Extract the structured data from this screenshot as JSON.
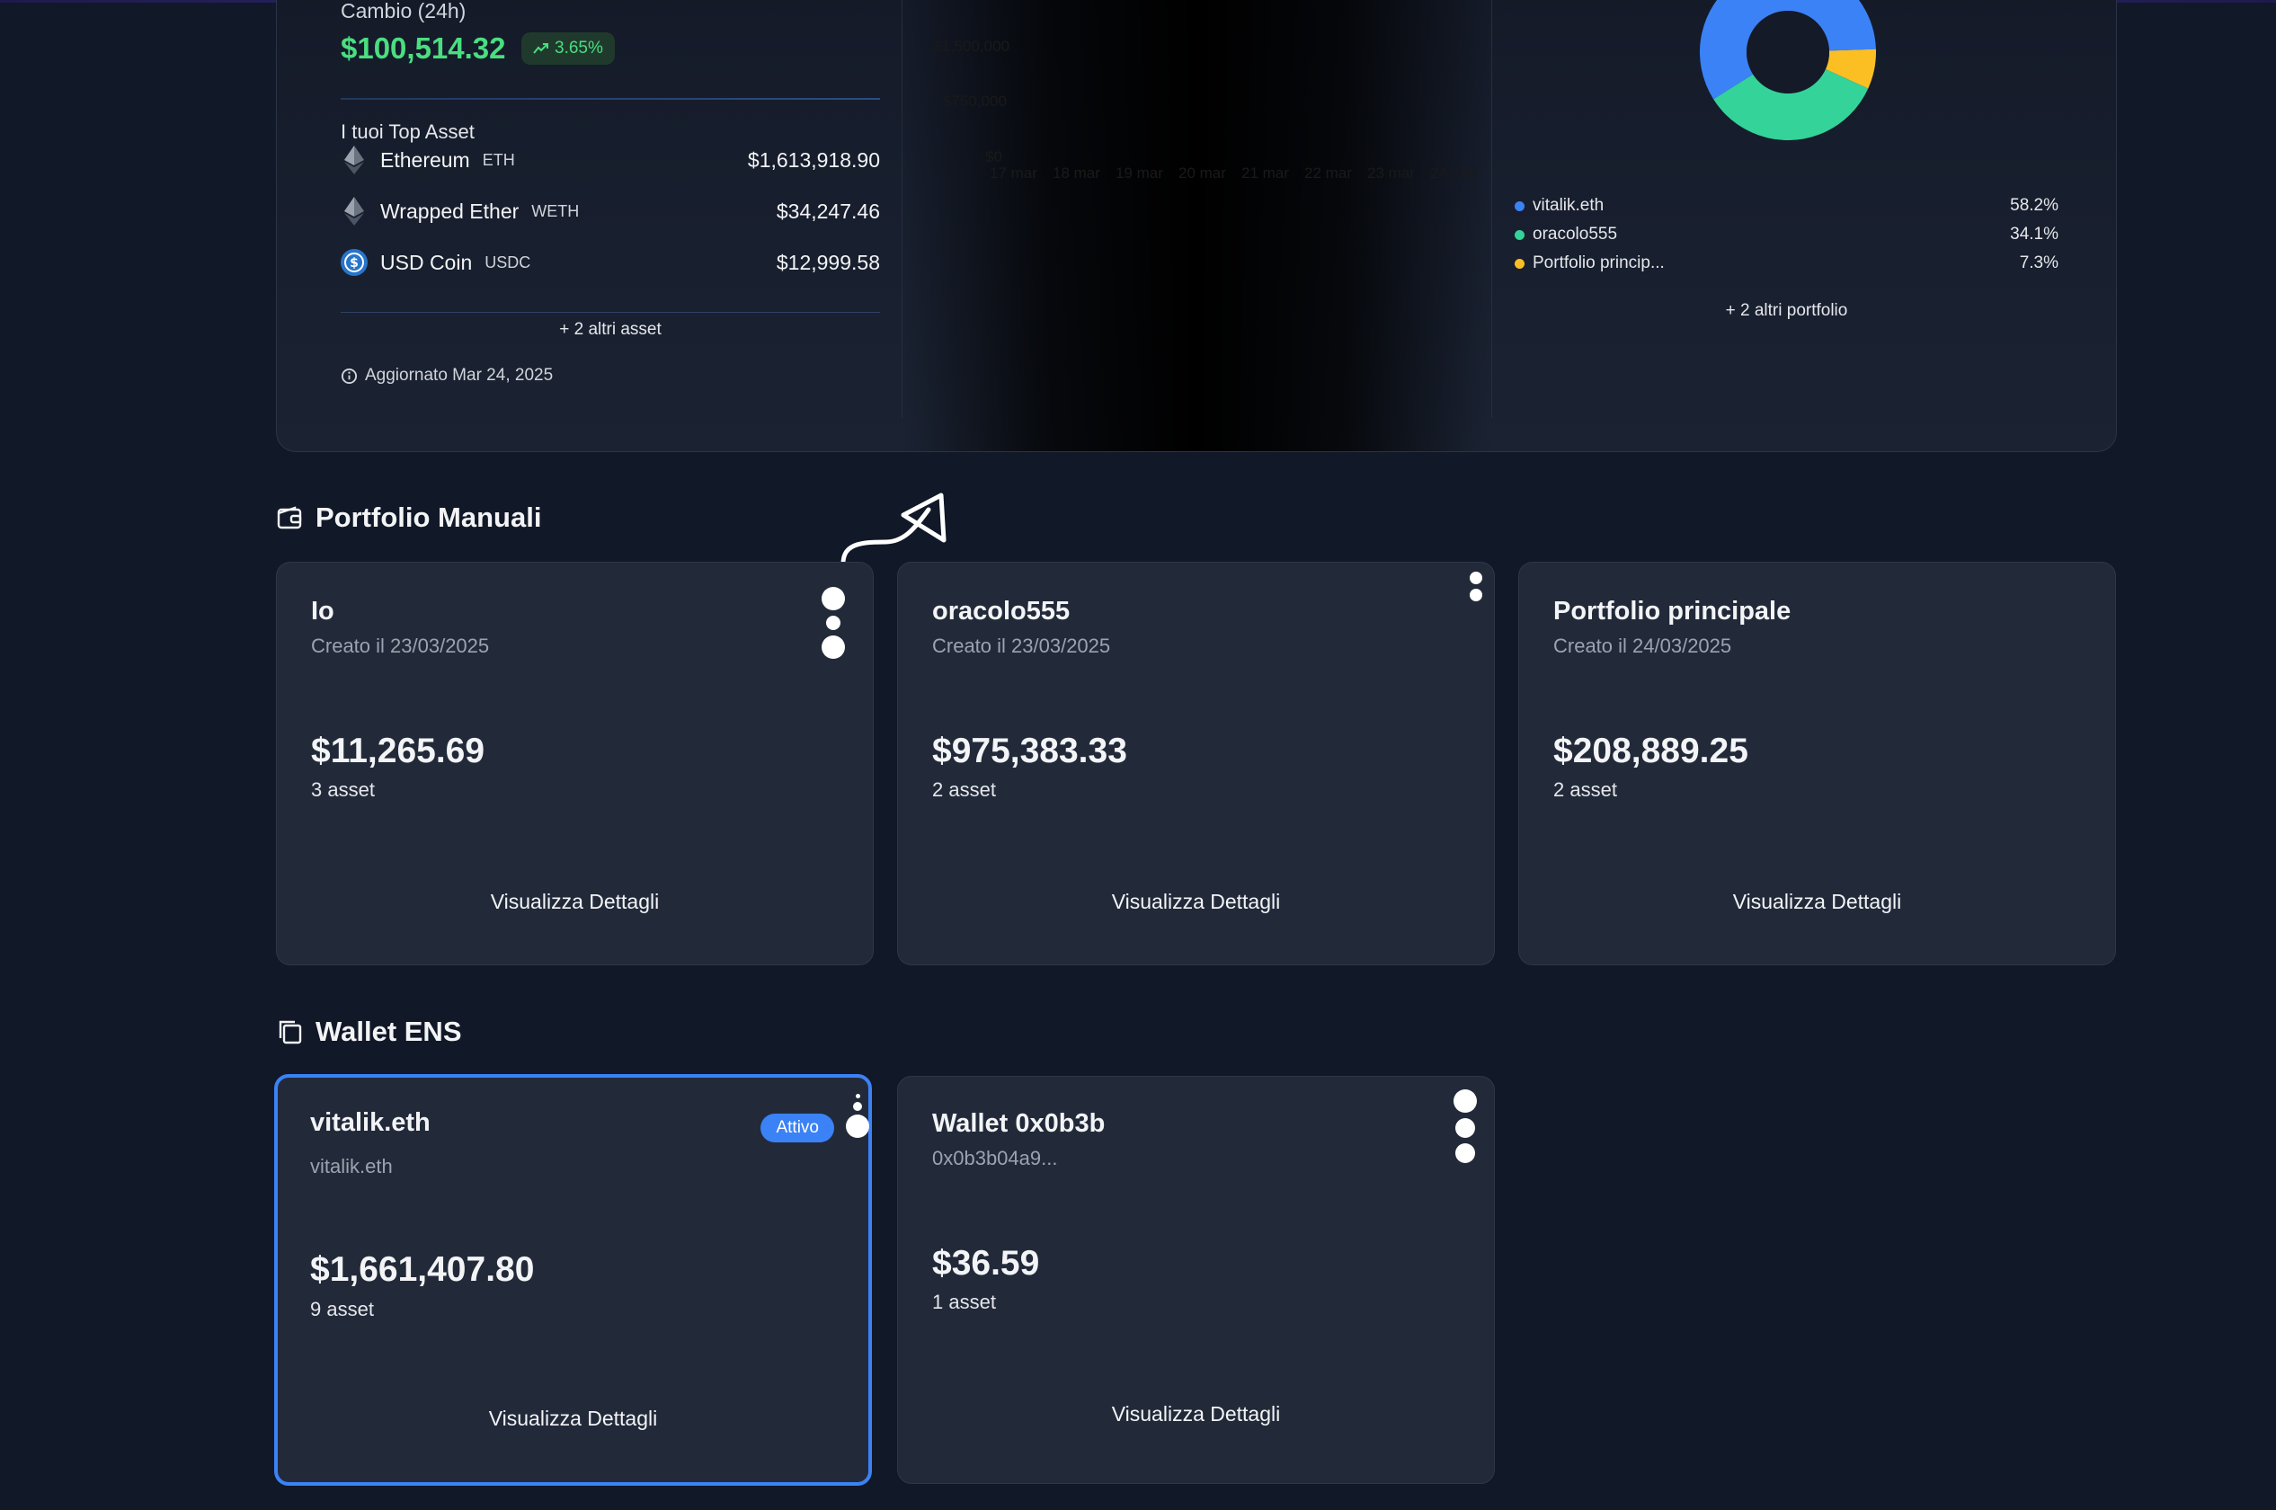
{
  "summary": {
    "change_label": "Cambio (24h)",
    "change_value": "$100,514.32",
    "change_pct": "3.65%",
    "top_assets_title": "I tuoi Top Asset",
    "top_assets": [
      {
        "name": "Ethereum",
        "symbol": "ETH",
        "value": "$1,613,918.90",
        "icon": "ethereum-icon"
      },
      {
        "name": "Wrapped Ether",
        "symbol": "WETH",
        "value": "$34,247.46",
        "icon": "weth-icon"
      },
      {
        "name": "USD Coin",
        "symbol": "USDC",
        "value": "$12,999.58",
        "icon": "usdc-icon"
      }
    ],
    "more_assets": "+ 2 altri asset",
    "updated": "Aggiornato Mar 24, 2025",
    "chart_ghost": {
      "y_ticks": [
        "$1,500,000",
        "$750,000",
        "$0"
      ],
      "x_ticks": [
        "17 mar",
        "18 mar",
        "19 mar",
        "20 mar",
        "21 mar",
        "22 mar",
        "23 mar",
        "24 mar"
      ]
    }
  },
  "distribution": {
    "legend": [
      {
        "name": "vitalik.eth",
        "pct": "58.2%",
        "color": "#3b82f6"
      },
      {
        "name": "oracolo555",
        "pct": "34.1%",
        "color": "#34d399"
      },
      {
        "name": "Portfolio princip...",
        "pct": "7.3%",
        "color": "#fbbf24"
      }
    ],
    "more": "+ 2 altri portfolio"
  },
  "chart_data": {
    "type": "pie",
    "categories": [
      "vitalik.eth",
      "oracolo555",
      "Portfolio princip..."
    ],
    "values": [
      58.2,
      34.1,
      7.3
    ],
    "colors": [
      "#3b82f6",
      "#34d399",
      "#fbbf24"
    ]
  },
  "manual": {
    "title": "Portfolio Manuali",
    "cards": [
      {
        "name": "Io",
        "created": "Creato il 23/03/2025",
        "value": "$11,265.69",
        "assets": "3 asset",
        "link": "Visualizza Dettagli"
      },
      {
        "name": "oracolo555",
        "created": "Creato il 23/03/2025",
        "value": "$975,383.33",
        "assets": "2 asset",
        "link": "Visualizza Dettagli"
      },
      {
        "name": "Portfolio principale",
        "created": "Creato il 24/03/2025",
        "value": "$208,889.25",
        "assets": "2 asset",
        "link": "Visualizza Dettagli"
      }
    ]
  },
  "wallets": {
    "title": "Wallet ENS",
    "cards": [
      {
        "name": "vitalik.eth",
        "address": "vitalik.eth",
        "badge": "Attivo",
        "value": "$1,661,407.80",
        "assets": "9 asset",
        "link": "Visualizza Dettagli"
      },
      {
        "name": "Wallet 0x0b3b",
        "address": "0x0b3b04a9...",
        "value": "$36.59",
        "assets": "1 asset",
        "link": "Visualizza Dettagli"
      }
    ]
  }
}
